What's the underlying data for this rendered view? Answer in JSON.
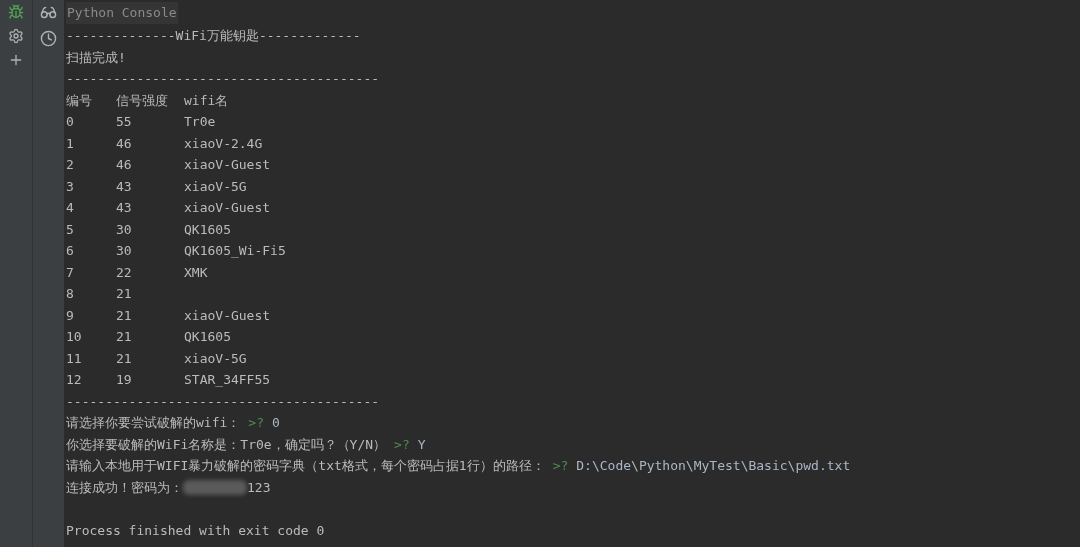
{
  "console_tab": {
    "title": "Python Console"
  },
  "output": [
    {
      "kind": "text",
      "text": "--------------WiFi万能钥匙-------------"
    },
    {
      "kind": "text",
      "text": "扫描完成!"
    },
    {
      "kind": "text",
      "text": "----------------------------------------"
    },
    {
      "kind": "row",
      "cells": [
        "编号",
        "信号强度",
        "wifi名"
      ]
    },
    {
      "kind": "row",
      "cells": [
        "0",
        "55",
        "Tr0e"
      ]
    },
    {
      "kind": "row",
      "cells": [
        "1",
        "46",
        "xiaoV-2.4G"
      ]
    },
    {
      "kind": "row",
      "cells": [
        "2",
        "46",
        "xiaoV-Guest"
      ]
    },
    {
      "kind": "row",
      "cells": [
        "3",
        "43",
        "xiaoV-5G"
      ]
    },
    {
      "kind": "row",
      "cells": [
        "4",
        "43",
        "xiaoV-Guest"
      ]
    },
    {
      "kind": "row",
      "cells": [
        "5",
        "30",
        "QK1605"
      ]
    },
    {
      "kind": "row",
      "cells": [
        "6",
        "30",
        "QK1605_Wi-Fi5"
      ]
    },
    {
      "kind": "row",
      "cells": [
        "7",
        "22",
        "XMK"
      ]
    },
    {
      "kind": "row",
      "cells": [
        "8",
        "21"
      ]
    },
    {
      "kind": "row",
      "cells": [
        "9",
        "21",
        "xiaoV-Guest"
      ]
    },
    {
      "kind": "row",
      "cells": [
        "10",
        "21",
        "QK1605"
      ]
    },
    {
      "kind": "row",
      "cells": [
        "11",
        "21",
        "xiaoV-5G"
      ]
    },
    {
      "kind": "row",
      "cells": [
        "12",
        "19",
        "STAR_34FF55"
      ]
    },
    {
      "kind": "text",
      "text": "----------------------------------------"
    },
    {
      "kind": "prompt",
      "text": "请选择你要尝试破解的wifi：",
      "marker": ">?",
      "input": "0"
    },
    {
      "kind": "prompt",
      "text": "你选择要破解的WiFi名称是：Tr0e，确定吗？（Y/N）",
      "marker": ">?",
      "input": "Y"
    },
    {
      "kind": "prompt",
      "text": "请输入本地用于WIFI暴力破解的密码字典（txt格式，每个密码占据1行）的路径：",
      "marker": ">?",
      "input": "D:\\Code\\Python\\MyTest\\Basic\\pwd.txt"
    },
    {
      "kind": "masked",
      "text": "连接成功！密码为：",
      "tail": "123"
    },
    {
      "kind": "blank"
    },
    {
      "kind": "text",
      "text": "Process finished with exit code 0"
    }
  ]
}
